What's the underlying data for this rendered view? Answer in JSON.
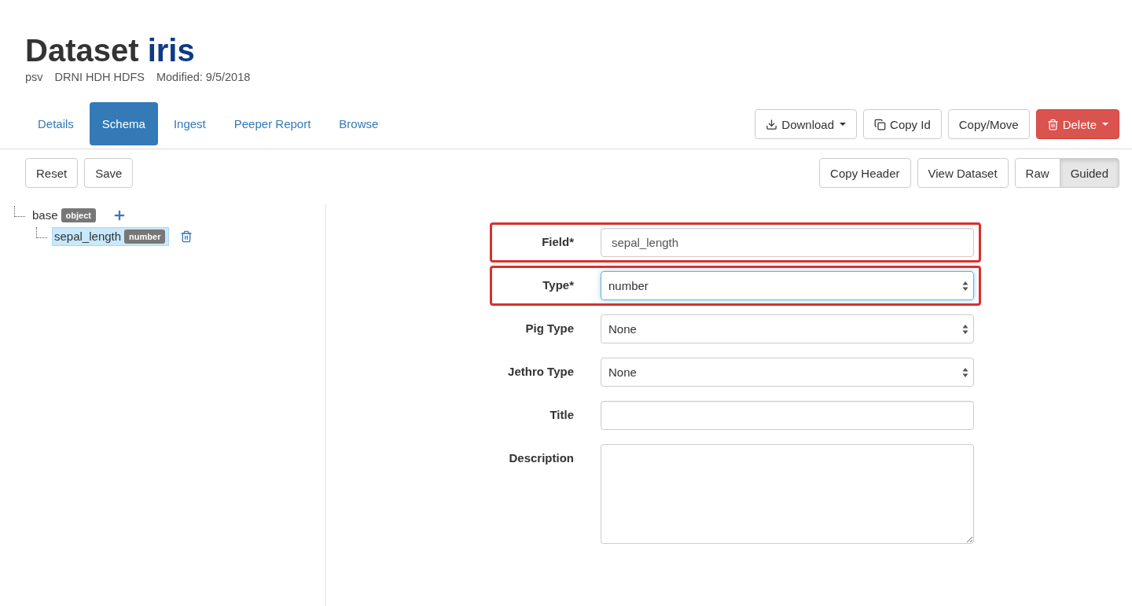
{
  "header": {
    "title": "Dataset",
    "name": "iris",
    "meta": [
      "psv",
      "DRNI HDH HDFS",
      "Modified: 9/5/2018"
    ]
  },
  "tabs": [
    {
      "label": "Details",
      "selected": false
    },
    {
      "label": "Schema",
      "selected": true
    },
    {
      "label": "Ingest",
      "selected": false
    },
    {
      "label": "Peeper Report",
      "selected": false
    },
    {
      "label": "Browse",
      "selected": false
    }
  ],
  "actions": [
    {
      "label": "Download",
      "kind": "download"
    },
    {
      "label": "Copy Id",
      "kind": "copy"
    },
    {
      "label": "Copy/Move",
      "kind": "plain"
    },
    {
      "label": "Delete",
      "kind": "delete"
    }
  ],
  "toolbar_left": [
    "Reset",
    "Save"
  ],
  "toolbar_right": [
    "Copy Header",
    "View Dataset"
  ],
  "mode_toggle": [
    {
      "label": "Raw",
      "selected": false
    },
    {
      "label": "Guided",
      "selected": true
    }
  ],
  "tree": {
    "label": "base",
    "badge": "object",
    "children": [
      {
        "label": "sepal_length",
        "badge": "number",
        "selected": true
      }
    ]
  },
  "form": [
    {
      "label": "Field*",
      "kind": "input",
      "value": "sepal_length",
      "highlighted": true,
      "focused": false
    },
    {
      "label": "Type*",
      "kind": "select",
      "value": "number",
      "highlighted": true,
      "focused": true
    },
    {
      "label": "Pig Type",
      "kind": "select",
      "value": "None",
      "highlighted": false,
      "focused": false
    },
    {
      "label": "Jethro Type",
      "kind": "select",
      "value": "None",
      "highlighted": false,
      "focused": false
    },
    {
      "label": "Title",
      "kind": "input",
      "highlighted": false,
      "focused": false
    },
    {
      "label": "Description",
      "kind": "textarea",
      "highlighted": false,
      "focused": false
    }
  ]
}
